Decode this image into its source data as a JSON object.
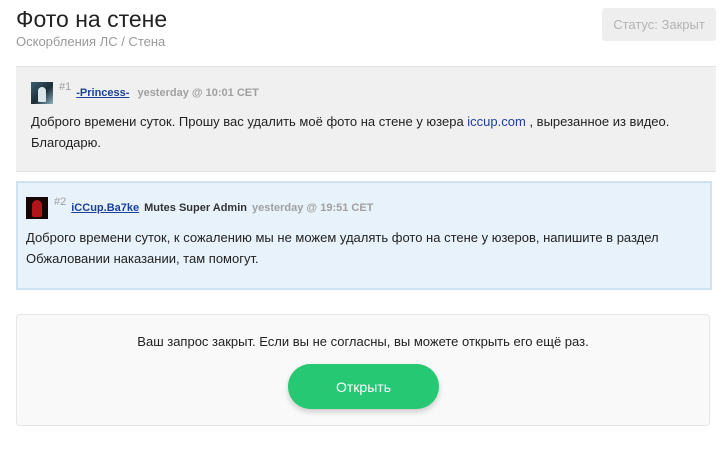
{
  "page": {
    "title": "Фото на стене",
    "breadcrumb": "Оскорбления ЛС / Стена",
    "status_label": "Статус: Закрыт"
  },
  "posts": [
    {
      "number": "#1",
      "author": "-Princess-",
      "role": "",
      "time": "yesterday @ 10:01 CET",
      "avatar_icon": "user-avatar-icon",
      "text_before_link": "Доброго времени суток. Прошу вас удалить моё фото на стене у юзера ",
      "link": "iccup.com",
      "text_after_link": " , вырезанное из видео. Благодарю."
    },
    {
      "number": "#2",
      "author": "iCCup.Ba7ke",
      "role": "Mutes Super Admin",
      "time": "yesterday @ 19:51 CET",
      "avatar_icon": "admin-avatar-icon",
      "text": "Доброго времени суток, к сожалению мы не можем удалять фото на стене у юзеров, напишите в раздел Обжаловании наказании, там помогут."
    }
  ],
  "closed_notice": {
    "text": "Ваш запрос закрыт. Если вы не согласны, вы можете открыть его ещё раз.",
    "button_label": "Открыть"
  },
  "colors": {
    "accent_green": "#27c874",
    "link_blue": "#1a3f9c",
    "admin_post_bg": "#e8f2fb",
    "user_post_bg": "#f0f0f0"
  }
}
